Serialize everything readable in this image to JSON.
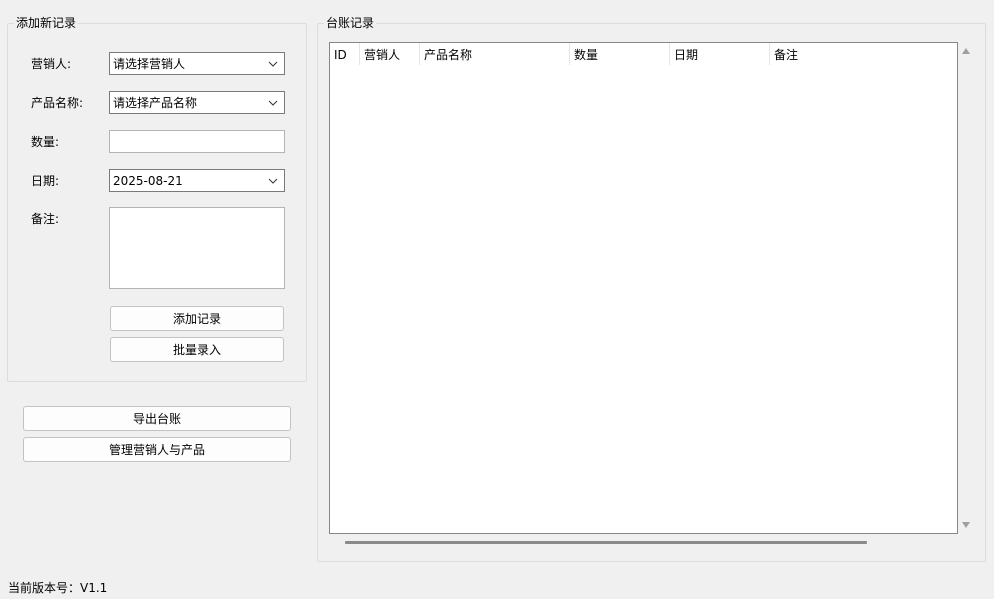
{
  "add_group": {
    "title": "添加新记录",
    "marketer_label": "营销人:",
    "marketer_value": "请选择营销人",
    "product_label": "产品名称:",
    "product_value": "请选择产品名称",
    "quantity_label": "数量:",
    "quantity_value": "",
    "date_label": "日期:",
    "date_value": "2025-08-21",
    "note_label": "备注:",
    "note_value": "",
    "add_button": "添加记录",
    "batch_button": "批量录入"
  },
  "export_button": "导出台账",
  "manage_button": "管理营销人与产品",
  "ledger_group": {
    "title": "台账记录",
    "columns": [
      "ID",
      "营销人",
      "产品名称",
      "数量",
      "日期",
      "备注"
    ]
  },
  "status": {
    "version": "当前版本号：V1.1"
  },
  "icons": {
    "combo_arrow": "chevron-down-icon",
    "scroll_up": "scroll-up-arrow-icon",
    "scroll_down": "scroll-down-arrow-icon"
  }
}
